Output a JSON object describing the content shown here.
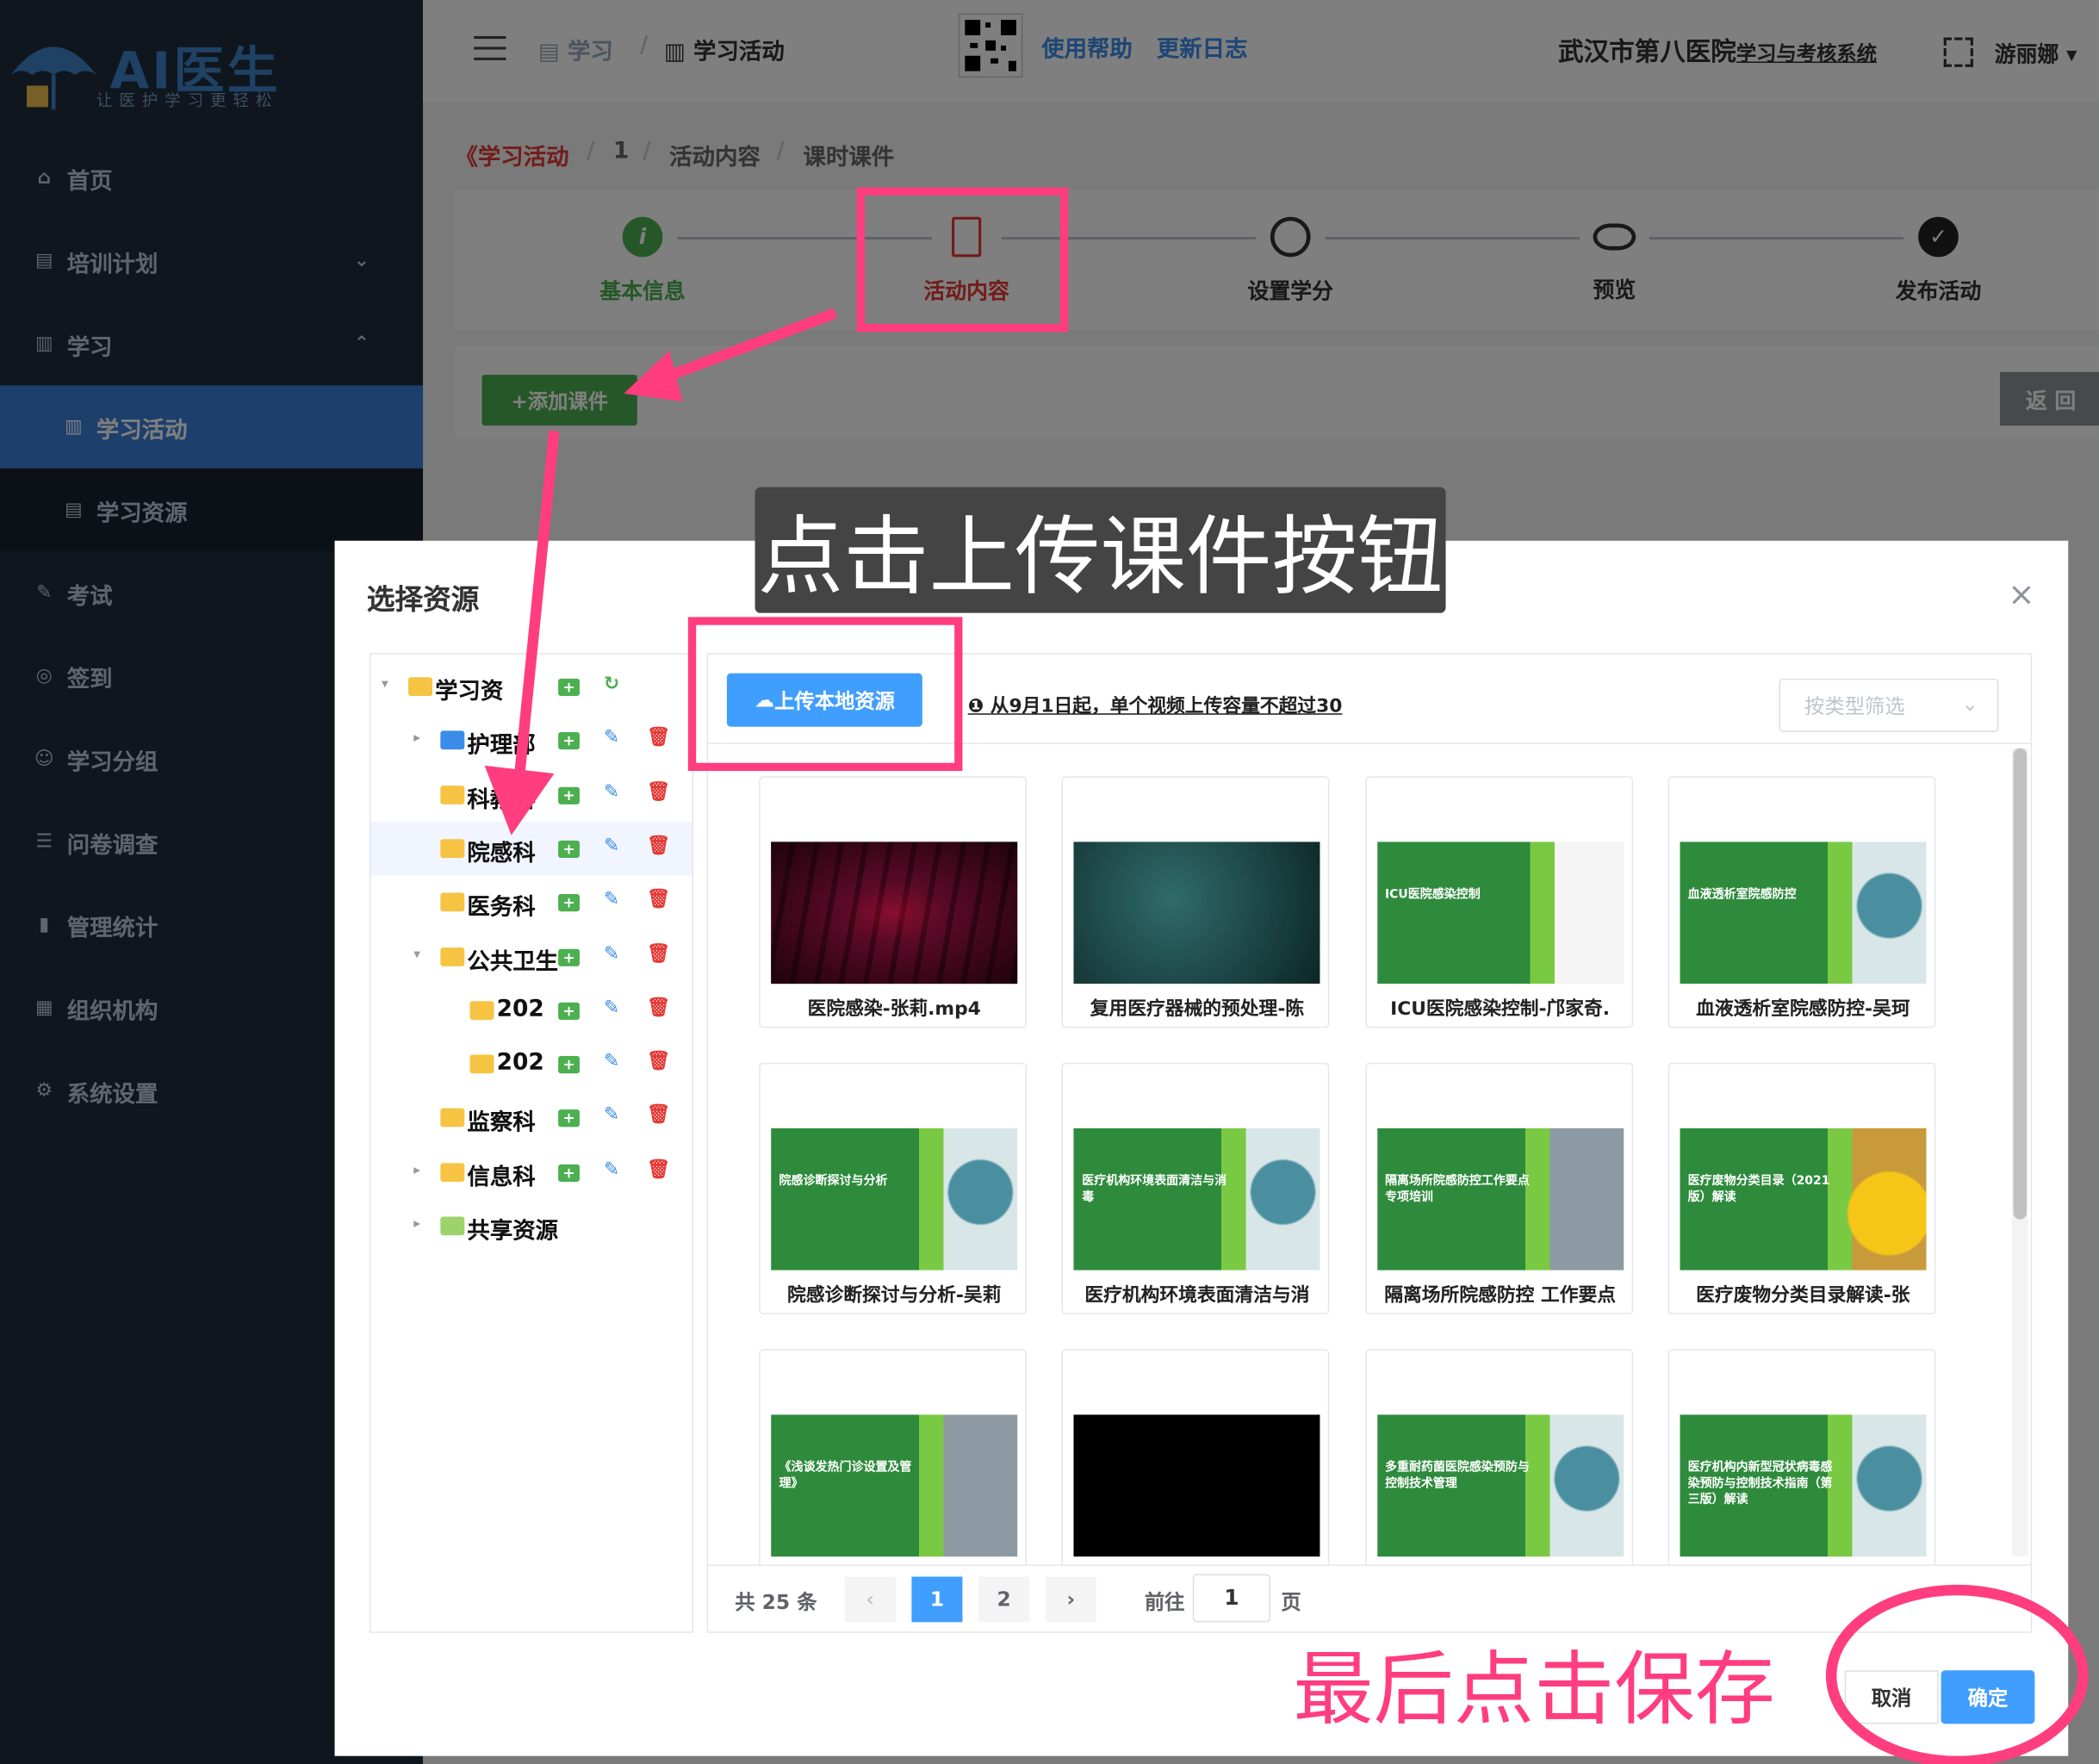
{
  "logo": {
    "title": "AI医生",
    "subtitle": "让医护学习更轻松"
  },
  "sidebar": {
    "items": [
      {
        "label": "首页",
        "icon": "home-icon"
      },
      {
        "label": "培训计划",
        "icon": "printer-icon",
        "arrow": "⌄"
      },
      {
        "label": "学习",
        "icon": "book-icon",
        "arrow": "⌃"
      },
      {
        "label": "学习活动",
        "icon": "book-icon"
      },
      {
        "label": "学习资源",
        "icon": "printer-icon"
      },
      {
        "label": "考试",
        "icon": "edit-icon"
      },
      {
        "label": "签到",
        "icon": "location-icon"
      },
      {
        "label": "学习分组",
        "icon": "user-icon"
      },
      {
        "label": "问卷调查",
        "icon": "document-icon"
      },
      {
        "label": "管理统计",
        "icon": "bar-chart-icon"
      },
      {
        "label": "组织机构",
        "icon": "building-icon"
      },
      {
        "label": "系统设置",
        "icon": "gear-icon"
      }
    ]
  },
  "navbar": {
    "crumb1": "学习",
    "sep": "/",
    "crumb2": "学习活动",
    "help": "使用帮助",
    "changelog": "更新日志",
    "hospital": "武汉市第八医院",
    "system": "学习与考核系统",
    "user": "游丽娜"
  },
  "breadcrumb": {
    "back": "《学习活动",
    "id": "1",
    "content": "活动内容",
    "courseware": "课时课件",
    "sep": "/"
  },
  "steps": [
    "基本信息",
    "活动内容",
    "设置学分",
    "预览",
    "发布活动"
  ],
  "toolbar": {
    "add": "+添加课件",
    "back": "返 回"
  },
  "dialog": {
    "title": "选择资源",
    "close": "×",
    "upload": "上传本地资源",
    "notice": "从9月1日起，单个视频上传容量不超过30",
    "filter_placeholder": "按类型筛选",
    "cancel": "取消",
    "ok": "确定"
  },
  "tree": [
    {
      "label": "学习资",
      "caret": "▾",
      "color": "yellow"
    },
    {
      "label": "护理部",
      "caret": "▸",
      "color": "blue"
    },
    {
      "label": "科教科",
      "caret": "",
      "color": "yellow"
    },
    {
      "label": "院感科",
      "caret": "",
      "color": "yellow"
    },
    {
      "label": "医务科",
      "caret": "",
      "color": "yellow"
    },
    {
      "label": "公共卫生",
      "caret": "▾",
      "color": "yellow"
    },
    {
      "label": "202",
      "caret": "",
      "color": "yellow"
    },
    {
      "label": "202",
      "caret": "",
      "color": "yellow"
    },
    {
      "label": "监察科",
      "caret": "",
      "color": "yellow"
    },
    {
      "label": "信息科",
      "caret": "▸",
      "color": "yellow"
    },
    {
      "label": "共享资源",
      "caret": "▸",
      "color": "green"
    }
  ],
  "resources": [
    {
      "title": "医院感染-张莉.mp4",
      "thumb": "film"
    },
    {
      "title": "复用医疗器械的预处理-陈",
      "thumb": "teal"
    },
    {
      "title": "ICU医院感染控制-邝家奇.",
      "thumb": "green",
      "caption": "ICU医院感染控制"
    },
    {
      "title": "血液透析室院感防控-吴珂",
      "thumb": "green-virus",
      "caption": "血液透析室院感防控"
    },
    {
      "title": "院感诊断探讨与分析-吴莉",
      "thumb": "green-virus",
      "caption": "院感诊断探讨与分析"
    },
    {
      "title": "医疗机构环境表面清洁与消",
      "thumb": "green-virus",
      "caption": "医疗机构环境表面清洁与消毒"
    },
    {
      "title": "隔离场所院感防控 工作要点",
      "thumb": "green-photo",
      "caption": "隔离场所院感防控工作要点专项培训"
    },
    {
      "title": "医疗废物分类目录解读-张",
      "thumb": "green-yellow",
      "caption": "医疗废物分类目录（2021版）解读"
    },
    {
      "title": "",
      "thumb": "green-photo",
      "caption": "《浅谈发热门诊设置及管理》"
    },
    {
      "title": "",
      "thumb": "black"
    },
    {
      "title": "",
      "thumb": "green-virus",
      "caption": "多重耐药菌医院感染预防与控制技术管理"
    },
    {
      "title": "",
      "thumb": "green-virus",
      "caption": "医疗机构内新型冠状病毒感染预防与控制技术指南（第三版）解读"
    }
  ],
  "pagination": {
    "total": "共 25 条",
    "prev": "‹",
    "pages": [
      "1",
      "2"
    ],
    "next": "›",
    "goto": "前往",
    "page_value": "1",
    "page_unit": "页"
  },
  "annotations": {
    "caption_top": "点击上传课件按钮",
    "caption_bottom": "最后点击保存"
  },
  "colors": {
    "primary": "#409eff",
    "success": "#4caf50",
    "annotation": "#ff3d7f",
    "sidebar": "#1f2d3d"
  }
}
